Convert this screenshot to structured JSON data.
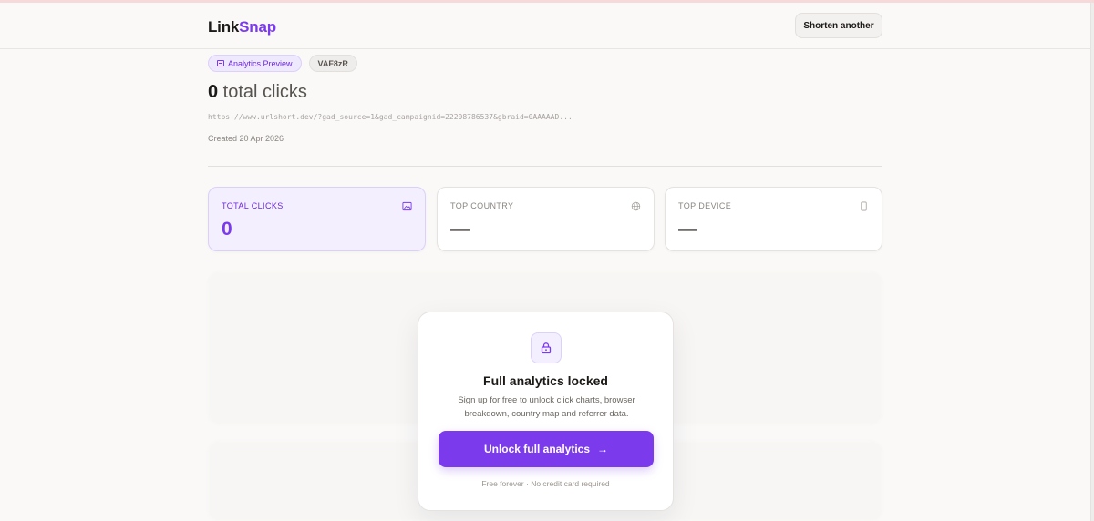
{
  "header": {
    "logo_main": "Link",
    "logo_accent": "Snap",
    "shorten_label": "Shorten another"
  },
  "link": {
    "preview_badge": "Analytics Preview",
    "code": "VAF8zR",
    "total_clicks_number": "0",
    "total_clicks_suffix": " total clicks",
    "url": "https://www.urlshort.dev/?gad_source=1&gad_campaignid=22208786537&gbraid=0AAAAAD...",
    "created": "Created 20 Apr 2026"
  },
  "stats": [
    {
      "label": "TOTAL CLICKS",
      "value": "0",
      "icon": "image-icon"
    },
    {
      "label": "TOP COUNTRY",
      "value": "—",
      "icon": "globe-icon"
    },
    {
      "label": "TOP DEVICE",
      "value": "—",
      "icon": "phone-icon"
    }
  ],
  "lock": {
    "icon": "lock-icon",
    "title": "Full analytics locked",
    "description": "Sign up for free to unlock click charts, browser breakdown, country map and referrer data.",
    "button_label": "Unlock full analytics",
    "button_arrow": "→",
    "footnote": "Free forever · No credit card required"
  },
  "colors": {
    "accent": "#7c3aed",
    "accent_light": "#f3effe",
    "background": "#faf9f8"
  }
}
